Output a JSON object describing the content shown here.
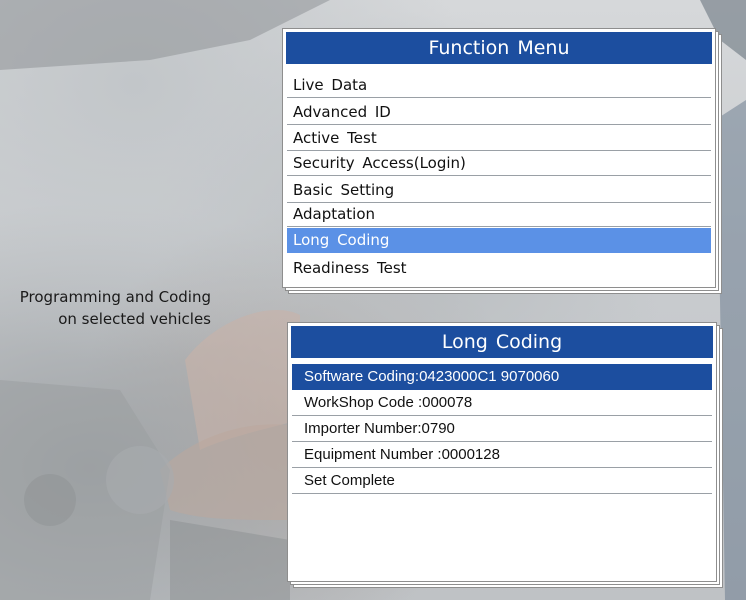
{
  "caption": {
    "line1": "Programming and Coding",
    "line2": "on selected vehicles"
  },
  "function_menu": {
    "title": "Function  Menu",
    "items": [
      {
        "label": "Live  Data",
        "selected": false
      },
      {
        "label": "Advanced  ID",
        "selected": false
      },
      {
        "label": "Active  Test",
        "selected": false
      },
      {
        "label": "Security  Access(Login)",
        "selected": false
      },
      {
        "label": "Basic  Setting",
        "selected": false
      },
      {
        "label": "Adaptation",
        "selected": false
      },
      {
        "label": "Long  Coding",
        "selected": true
      },
      {
        "label": "Readiness Test",
        "selected": false
      }
    ]
  },
  "long_coding": {
    "title": "Long Coding",
    "rows": [
      {
        "label": "Software Coding:0423000C1 9070060",
        "selected": true
      },
      {
        "label": "WorkShop Code :000078",
        "selected": false
      },
      {
        "label": "Importer Number:0790",
        "selected": false
      },
      {
        "label": "Equipment Number :0000128",
        "selected": false
      },
      {
        "label": "Set Complete",
        "selected": false
      }
    ]
  },
  "colors": {
    "title_bar": "#1c4e9f",
    "menu_highlight": "#5b91e6",
    "row_divider": "#9aa0a6"
  }
}
